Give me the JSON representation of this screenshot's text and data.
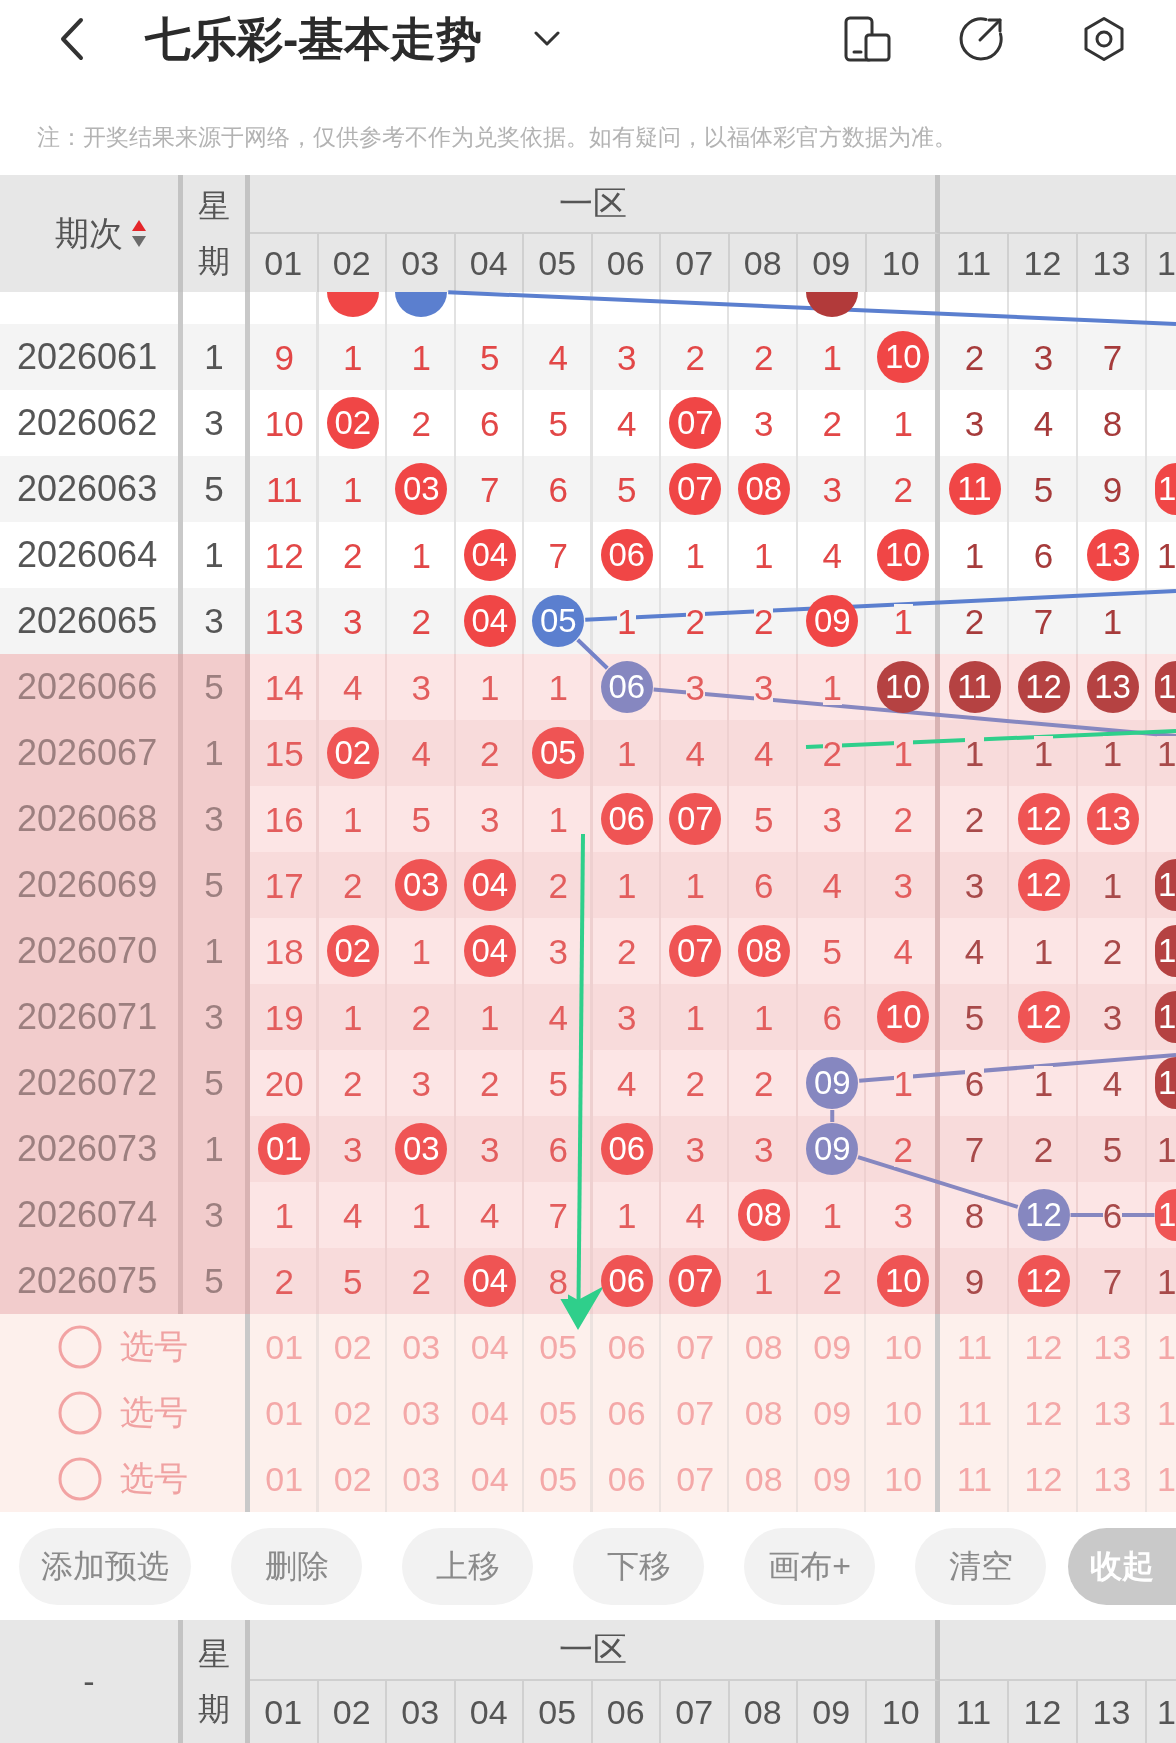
{
  "top_bar": {
    "title": "七乐彩-基本走势"
  },
  "notice": "注：开奖结果来源于网络，仅供参考不作为兑奖依据。如有疑问，以福体彩官方数据为准。",
  "table": {
    "header": {
      "period": "期次",
      "sort_ascending": true,
      "weekday": "星期",
      "zone": "一区",
      "columns": [
        "01",
        "02",
        "03",
        "04",
        "05",
        "06",
        "07",
        "08",
        "09",
        "10",
        "11",
        "12",
        "13",
        "1"
      ]
    },
    "partial_row": {
      "cells": [
        {
          "kind": "miss"
        },
        {
          "kind": "hit"
        },
        {
          "kind": "marked",
          "color": "#5b7fcf"
        },
        {
          "kind": "miss"
        },
        {
          "kind": "miss"
        },
        {
          "kind": "miss"
        },
        {
          "kind": "miss"
        },
        {
          "kind": "miss"
        },
        {
          "kind": "consecutive"
        },
        {
          "kind": "miss"
        },
        {
          "kind": "miss"
        },
        {
          "kind": "miss"
        },
        {
          "kind": "miss"
        },
        {
          "kind": "miss"
        }
      ]
    },
    "rows": [
      {
        "period": "2026061",
        "weekday": "1",
        "highlighted": false,
        "cells": [
          {
            "value": "9",
            "kind": "miss"
          },
          {
            "value": "1",
            "kind": "miss"
          },
          {
            "value": "1",
            "kind": "miss"
          },
          {
            "value": "5",
            "kind": "miss"
          },
          {
            "value": "4",
            "kind": "miss"
          },
          {
            "value": "3",
            "kind": "miss"
          },
          {
            "value": "2",
            "kind": "miss"
          },
          {
            "value": "2",
            "kind": "miss"
          },
          {
            "value": "1",
            "kind": "miss"
          },
          {
            "value": "10",
            "kind": "hit"
          },
          {
            "value": "2",
            "kind": "miss"
          },
          {
            "value": "3",
            "kind": "miss"
          },
          {
            "value": "7",
            "kind": "miss"
          },
          {
            "kind": "miss"
          }
        ]
      },
      {
        "period": "2026062",
        "weekday": "3",
        "highlighted": false,
        "cells": [
          {
            "value": "10",
            "kind": "miss"
          },
          {
            "value": "02",
            "kind": "hit"
          },
          {
            "value": "2",
            "kind": "miss"
          },
          {
            "value": "6",
            "kind": "miss"
          },
          {
            "value": "5",
            "kind": "miss"
          },
          {
            "value": "4",
            "kind": "miss"
          },
          {
            "value": "07",
            "kind": "hit"
          },
          {
            "value": "3",
            "kind": "miss"
          },
          {
            "value": "2",
            "kind": "miss"
          },
          {
            "value": "1",
            "kind": "miss"
          },
          {
            "value": "3",
            "kind": "miss"
          },
          {
            "value": "4",
            "kind": "miss"
          },
          {
            "value": "8",
            "kind": "miss"
          },
          {
            "kind": "miss"
          }
        ]
      },
      {
        "period": "2026063",
        "weekday": "5",
        "highlighted": false,
        "cells": [
          {
            "value": "11",
            "kind": "miss"
          },
          {
            "value": "1",
            "kind": "miss"
          },
          {
            "value": "03",
            "kind": "hit"
          },
          {
            "value": "7",
            "kind": "miss"
          },
          {
            "value": "6",
            "kind": "miss"
          },
          {
            "value": "5",
            "kind": "miss"
          },
          {
            "value": "07",
            "kind": "hit"
          },
          {
            "value": "08",
            "kind": "hit"
          },
          {
            "value": "3",
            "kind": "miss"
          },
          {
            "value": "2",
            "kind": "miss"
          },
          {
            "value": "11",
            "kind": "hit"
          },
          {
            "value": "5",
            "kind": "miss"
          },
          {
            "value": "9",
            "kind": "miss"
          },
          {
            "value": "1",
            "kind": "hit"
          }
        ]
      },
      {
        "period": "2026064",
        "weekday": "1",
        "highlighted": false,
        "cells": [
          {
            "value": "12",
            "kind": "miss"
          },
          {
            "value": "2",
            "kind": "miss"
          },
          {
            "value": "1",
            "kind": "miss"
          },
          {
            "value": "04",
            "kind": "hit"
          },
          {
            "value": "7",
            "kind": "miss"
          },
          {
            "value": "06",
            "kind": "hit"
          },
          {
            "value": "1",
            "kind": "miss"
          },
          {
            "value": "1",
            "kind": "miss"
          },
          {
            "value": "4",
            "kind": "miss"
          },
          {
            "value": "10",
            "kind": "hit"
          },
          {
            "value": "1",
            "kind": "miss"
          },
          {
            "value": "6",
            "kind": "miss"
          },
          {
            "value": "13",
            "kind": "hit"
          },
          {
            "value": "1",
            "kind": "miss"
          }
        ]
      },
      {
        "period": "2026065",
        "weekday": "3",
        "highlighted": false,
        "cells": [
          {
            "value": "13",
            "kind": "miss"
          },
          {
            "value": "3",
            "kind": "miss"
          },
          {
            "value": "2",
            "kind": "miss"
          },
          {
            "value": "04",
            "kind": "hit"
          },
          {
            "value": "05",
            "kind": "marked",
            "color": "#5b7fcf"
          },
          {
            "value": "1",
            "kind": "miss"
          },
          {
            "value": "2",
            "kind": "miss"
          },
          {
            "value": "2",
            "kind": "miss"
          },
          {
            "value": "09",
            "kind": "hit"
          },
          {
            "value": "1",
            "kind": "miss"
          },
          {
            "value": "2",
            "kind": "miss"
          },
          {
            "value": "7",
            "kind": "miss"
          },
          {
            "value": "1",
            "kind": "miss"
          },
          {
            "kind": "miss"
          }
        ]
      },
      {
        "period": "2026066",
        "weekday": "5",
        "highlighted": true,
        "cells": [
          {
            "value": "14",
            "kind": "miss"
          },
          {
            "value": "4",
            "kind": "miss"
          },
          {
            "value": "3",
            "kind": "miss"
          },
          {
            "value": "1",
            "kind": "miss"
          },
          {
            "value": "1",
            "kind": "miss"
          },
          {
            "value": "06",
            "kind": "marked",
            "color": "#8687c0"
          },
          {
            "value": "3",
            "kind": "miss"
          },
          {
            "value": "3",
            "kind": "miss"
          },
          {
            "value": "1",
            "kind": "miss"
          },
          {
            "value": "10",
            "kind": "consecutive"
          },
          {
            "value": "11",
            "kind": "consecutive"
          },
          {
            "value": "12",
            "kind": "consecutive"
          },
          {
            "value": "13",
            "kind": "consecutive"
          },
          {
            "value": "1",
            "kind": "consecutive"
          }
        ]
      },
      {
        "period": "2026067",
        "weekday": "1",
        "highlighted": true,
        "cells": [
          {
            "value": "15",
            "kind": "miss"
          },
          {
            "value": "02",
            "kind": "hit"
          },
          {
            "value": "4",
            "kind": "miss"
          },
          {
            "value": "2",
            "kind": "miss"
          },
          {
            "value": "05",
            "kind": "hit"
          },
          {
            "value": "1",
            "kind": "miss"
          },
          {
            "value": "4",
            "kind": "miss"
          },
          {
            "value": "4",
            "kind": "miss"
          },
          {
            "value": "2",
            "kind": "miss"
          },
          {
            "value": "1",
            "kind": "miss"
          },
          {
            "value": "1",
            "kind": "miss"
          },
          {
            "value": "1",
            "kind": "miss"
          },
          {
            "value": "1",
            "kind": "miss"
          },
          {
            "value": "1",
            "kind": "miss"
          }
        ]
      },
      {
        "period": "2026068",
        "weekday": "3",
        "highlighted": true,
        "cells": [
          {
            "value": "16",
            "kind": "miss"
          },
          {
            "value": "1",
            "kind": "miss"
          },
          {
            "value": "5",
            "kind": "miss"
          },
          {
            "value": "3",
            "kind": "miss"
          },
          {
            "value": "1",
            "kind": "miss"
          },
          {
            "value": "06",
            "kind": "hit"
          },
          {
            "value": "07",
            "kind": "hit"
          },
          {
            "value": "5",
            "kind": "miss"
          },
          {
            "value": "3",
            "kind": "miss"
          },
          {
            "value": "2",
            "kind": "miss"
          },
          {
            "value": "2",
            "kind": "miss"
          },
          {
            "value": "12",
            "kind": "hit"
          },
          {
            "value": "13",
            "kind": "hit"
          },
          {
            "kind": "miss"
          }
        ]
      },
      {
        "period": "2026069",
        "weekday": "5",
        "highlighted": true,
        "cells": [
          {
            "value": "17",
            "kind": "miss"
          },
          {
            "value": "2",
            "kind": "miss"
          },
          {
            "value": "03",
            "kind": "hit"
          },
          {
            "value": "04",
            "kind": "hit"
          },
          {
            "value": "2",
            "kind": "miss"
          },
          {
            "value": "1",
            "kind": "miss"
          },
          {
            "value": "1",
            "kind": "miss"
          },
          {
            "value": "6",
            "kind": "miss"
          },
          {
            "value": "4",
            "kind": "miss"
          },
          {
            "value": "3",
            "kind": "miss"
          },
          {
            "value": "3",
            "kind": "miss"
          },
          {
            "value": "12",
            "kind": "hit"
          },
          {
            "value": "1",
            "kind": "miss"
          },
          {
            "value": "1",
            "kind": "consecutive"
          }
        ]
      },
      {
        "period": "2026070",
        "weekday": "1",
        "highlighted": true,
        "cells": [
          {
            "value": "18",
            "kind": "miss"
          },
          {
            "value": "02",
            "kind": "hit"
          },
          {
            "value": "1",
            "kind": "miss"
          },
          {
            "value": "04",
            "kind": "hit"
          },
          {
            "value": "3",
            "kind": "miss"
          },
          {
            "value": "2",
            "kind": "miss"
          },
          {
            "value": "07",
            "kind": "hit"
          },
          {
            "value": "08",
            "kind": "hit"
          },
          {
            "value": "5",
            "kind": "miss"
          },
          {
            "value": "4",
            "kind": "miss"
          },
          {
            "value": "4",
            "kind": "miss"
          },
          {
            "value": "1",
            "kind": "miss"
          },
          {
            "value": "2",
            "kind": "miss"
          },
          {
            "value": "1",
            "kind": "consecutive"
          }
        ]
      },
      {
        "period": "2026071",
        "weekday": "3",
        "highlighted": true,
        "cells": [
          {
            "value": "19",
            "kind": "miss"
          },
          {
            "value": "1",
            "kind": "miss"
          },
          {
            "value": "2",
            "kind": "miss"
          },
          {
            "value": "1",
            "kind": "miss"
          },
          {
            "value": "4",
            "kind": "miss"
          },
          {
            "value": "3",
            "kind": "miss"
          },
          {
            "value": "1",
            "kind": "miss"
          },
          {
            "value": "1",
            "kind": "miss"
          },
          {
            "value": "6",
            "kind": "miss"
          },
          {
            "value": "10",
            "kind": "hit"
          },
          {
            "value": "5",
            "kind": "miss"
          },
          {
            "value": "12",
            "kind": "hit"
          },
          {
            "value": "3",
            "kind": "miss"
          },
          {
            "value": "1",
            "kind": "consecutive"
          }
        ]
      },
      {
        "period": "2026072",
        "weekday": "5",
        "highlighted": true,
        "cells": [
          {
            "value": "20",
            "kind": "miss"
          },
          {
            "value": "2",
            "kind": "miss"
          },
          {
            "value": "3",
            "kind": "miss"
          },
          {
            "value": "2",
            "kind": "miss"
          },
          {
            "value": "5",
            "kind": "miss"
          },
          {
            "value": "4",
            "kind": "miss"
          },
          {
            "value": "2",
            "kind": "miss"
          },
          {
            "value": "2",
            "kind": "miss"
          },
          {
            "value": "09",
            "kind": "marked",
            "color": "#8687c0"
          },
          {
            "value": "1",
            "kind": "miss"
          },
          {
            "value": "6",
            "kind": "miss"
          },
          {
            "value": "1",
            "kind": "miss"
          },
          {
            "value": "4",
            "kind": "miss"
          },
          {
            "value": "1",
            "kind": "consecutive"
          }
        ]
      },
      {
        "period": "2026073",
        "weekday": "1",
        "highlighted": true,
        "cells": [
          {
            "value": "01",
            "kind": "hit"
          },
          {
            "value": "3",
            "kind": "miss"
          },
          {
            "value": "03",
            "kind": "hit"
          },
          {
            "value": "3",
            "kind": "miss"
          },
          {
            "value": "6",
            "kind": "miss"
          },
          {
            "value": "06",
            "kind": "hit"
          },
          {
            "value": "3",
            "kind": "miss"
          },
          {
            "value": "3",
            "kind": "miss"
          },
          {
            "value": "09",
            "kind": "marked",
            "color": "#8687c0"
          },
          {
            "value": "2",
            "kind": "miss"
          },
          {
            "value": "7",
            "kind": "miss"
          },
          {
            "value": "2",
            "kind": "miss"
          },
          {
            "value": "5",
            "kind": "miss"
          },
          {
            "value": "1",
            "kind": "miss"
          }
        ]
      },
      {
        "period": "2026074",
        "weekday": "3",
        "highlighted": true,
        "cells": [
          {
            "value": "1",
            "kind": "miss"
          },
          {
            "value": "4",
            "kind": "miss"
          },
          {
            "value": "1",
            "kind": "miss"
          },
          {
            "value": "4",
            "kind": "miss"
          },
          {
            "value": "7",
            "kind": "miss"
          },
          {
            "value": "1",
            "kind": "miss"
          },
          {
            "value": "4",
            "kind": "miss"
          },
          {
            "value": "08",
            "kind": "hit"
          },
          {
            "value": "1",
            "kind": "miss"
          },
          {
            "value": "3",
            "kind": "miss"
          },
          {
            "value": "8",
            "kind": "miss"
          },
          {
            "value": "12",
            "kind": "marked",
            "color": "#8687c0"
          },
          {
            "value": "6",
            "kind": "miss"
          },
          {
            "value": "1",
            "kind": "hit"
          }
        ]
      },
      {
        "period": "2026075",
        "weekday": "5",
        "highlighted": true,
        "cells": [
          {
            "value": "2",
            "kind": "miss"
          },
          {
            "value": "5",
            "kind": "miss"
          },
          {
            "value": "2",
            "kind": "miss"
          },
          {
            "value": "04",
            "kind": "hit"
          },
          {
            "value": "8",
            "kind": "miss"
          },
          {
            "value": "06",
            "kind": "hit"
          },
          {
            "value": "07",
            "kind": "hit"
          },
          {
            "value": "1",
            "kind": "miss"
          },
          {
            "value": "2",
            "kind": "miss"
          },
          {
            "value": "10",
            "kind": "hit"
          },
          {
            "value": "9",
            "kind": "miss"
          },
          {
            "value": "12",
            "kind": "hit"
          },
          {
            "value": "7",
            "kind": "miss"
          },
          {
            "value": "1",
            "kind": "miss"
          }
        ]
      }
    ],
    "picks": [
      {
        "label": "选号",
        "selected": false,
        "numbers": [
          {
            "value": "01",
            "selected": false
          },
          {
            "value": "02",
            "selected": false
          },
          {
            "value": "03",
            "selected": false
          },
          {
            "value": "04",
            "selected": false
          },
          {
            "value": "05",
            "selected": false
          },
          {
            "value": "06",
            "selected": false
          },
          {
            "value": "07",
            "selected": false
          },
          {
            "value": "08",
            "selected": false
          },
          {
            "value": "09",
            "selected": false
          },
          {
            "value": "10",
            "selected": false
          },
          {
            "value": "11",
            "selected": false
          },
          {
            "value": "12",
            "selected": false
          },
          {
            "value": "13",
            "selected": false
          },
          {
            "value": "1",
            "selected": false
          }
        ]
      },
      {
        "label": "选号",
        "selected": false,
        "numbers": [
          {
            "value": "01",
            "selected": false
          },
          {
            "value": "02",
            "selected": false
          },
          {
            "value": "03",
            "selected": false
          },
          {
            "value": "04",
            "selected": false
          },
          {
            "value": "05",
            "selected": false
          },
          {
            "value": "06",
            "selected": false
          },
          {
            "value": "07",
            "selected": false
          },
          {
            "value": "08",
            "selected": false
          },
          {
            "value": "09",
            "selected": false
          },
          {
            "value": "10",
            "selected": false
          },
          {
            "value": "11",
            "selected": false
          },
          {
            "value": "12",
            "selected": false
          },
          {
            "value": "13",
            "selected": false
          },
          {
            "value": "1",
            "selected": false
          }
        ]
      },
      {
        "label": "选号",
        "selected": false,
        "numbers": [
          {
            "value": "01",
            "selected": false
          },
          {
            "value": "02",
            "selected": false
          },
          {
            "value": "03",
            "selected": false
          },
          {
            "value": "04",
            "selected": false
          },
          {
            "value": "05",
            "selected": false
          },
          {
            "value": "06",
            "selected": false
          },
          {
            "value": "07",
            "selected": false
          },
          {
            "value": "08",
            "selected": false
          },
          {
            "value": "09",
            "selected": false
          },
          {
            "value": "10",
            "selected": false
          },
          {
            "value": "11",
            "selected": false
          },
          {
            "value": "12",
            "selected": false
          },
          {
            "value": "13",
            "selected": false
          },
          {
            "value": "1",
            "selected": false
          }
        ]
      }
    ]
  },
  "actions": [
    {
      "label": "添加预选",
      "kind": "plain"
    },
    {
      "label": "删除",
      "kind": "plain"
    },
    {
      "label": "上移",
      "kind": "plain"
    },
    {
      "label": "下移",
      "kind": "plain"
    },
    {
      "label": "画布+",
      "kind": "plain"
    },
    {
      "label": "清空",
      "kind": "plain"
    },
    {
      "label": "收起",
      "kind": "primary"
    }
  ],
  "footer_header": {
    "period": "-",
    "weekday": "星期",
    "zone": "一区",
    "columns": [
      "01",
      "02",
      "03",
      "04",
      "05",
      "06",
      "07",
      "08",
      "09",
      "10",
      "11",
      "12",
      "13",
      "1"
    ]
  }
}
